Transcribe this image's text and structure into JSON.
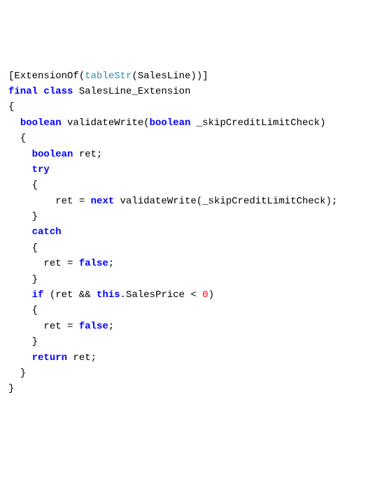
{
  "code": {
    "line1": {
      "attr_open": "[",
      "extensionof": "ExtensionOf",
      "paren1": "(",
      "tablestr": "tableStr",
      "paren2": "(SalesLine))]"
    },
    "line2": {
      "final": "final",
      "class": " class",
      "classname": " SalesLine_Extension"
    },
    "line3": "{",
    "line4": {
      "indent": "  ",
      "boolean": "boolean",
      "method": " validateWrite(",
      "param_type": "boolean",
      "param_name": " _skipCreditLimitCheck)"
    },
    "line5": "  {",
    "line6": {
      "indent": "    ",
      "boolean": "boolean",
      "var": " ret;"
    },
    "line7": {
      "indent": "    ",
      "try": "try"
    },
    "line8": "    {",
    "line9": {
      "indent": "        ",
      "ret_eq": "ret = ",
      "next": "next",
      "call": " validateWrite(_skipCreditLimitCheck);"
    },
    "line10": "    }",
    "line11": {
      "indent": "    ",
      "catch": "catch"
    },
    "line12": "    {",
    "line13": {
      "indent": "      ",
      "ret_eq": "ret = ",
      "false": "false",
      "semi": ";"
    },
    "line14": "    }",
    "line15": {
      "indent": "    ",
      "if": "if",
      "paren": " (ret && ",
      "this": "this",
      "cond": ".SalesPrice < ",
      "zero": "0",
      "close": ")"
    },
    "line16": "    {",
    "line17": {
      "indent": "      ",
      "ret_eq": "ret = ",
      "false": "false",
      "semi": ";"
    },
    "line18": "    }",
    "line19": {
      "indent": "    ",
      "return": "return",
      "ret": " ret;"
    },
    "line20": "  }",
    "line21": "}"
  }
}
